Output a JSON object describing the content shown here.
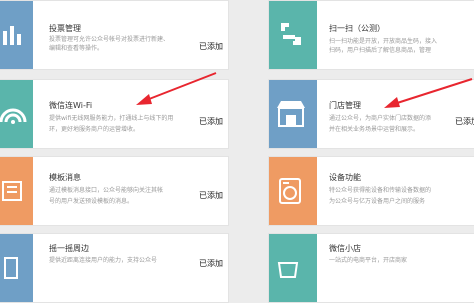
{
  "cards": [
    {
      "title": "投票管理",
      "desc1": "投票管理可允许公众号帐号对投票进行新建、",
      "desc2": "编辑和查看等操作。",
      "status": "已添加",
      "icon": "bar-chart-icon"
    },
    {
      "title": "扫一扫（公测）",
      "desc1": "扫一扫功能是开放，开放商品生码，接入",
      "desc2": "扫码，用户扫描后了解信息商品，管理",
      "status": "",
      "icon": "scan-icon"
    },
    {
      "title": "微信连Wi-Fi",
      "desc1": "提供wifi无线网服务能力，打通线上与线下的用",
      "desc2": "环，更好地服务商户的运营增收。",
      "status": "已添加",
      "icon": "wifi-icon"
    },
    {
      "title": "门店管理",
      "desc1": "通过公众号，为商户实体门店数据的添",
      "desc2": "并在相关业务场景中运营和展示。",
      "status": "已添加",
      "icon": "store-icon"
    },
    {
      "title": "模板消息",
      "desc1": "通过模板消息接口，公众号能够向关注其帐",
      "desc2": "号的用户发送预设模板的消息。",
      "status": "已添加",
      "icon": "message-template-icon"
    },
    {
      "title": "设备功能",
      "desc1": "特公众号获得能设备和传输设备数据的",
      "desc2": "为公众号与亿万设备用户之间的服务",
      "status": "",
      "icon": "device-icon"
    },
    {
      "title": "摇一摇周边",
      "desc1": "提供近距离连接用户的能力，支持公众号",
      "desc2": "",
      "status": "已添加",
      "icon": "shake-icon"
    },
    {
      "title": "微信小店",
      "desc1": "一站式的电商平台，开店商家",
      "desc2": "",
      "status": "",
      "icon": "shop-icon"
    }
  ],
  "colors": {
    "blue": "#6f9fc6",
    "teal": "#5ab5ab",
    "orange": "#ef9b63",
    "arrow": "#e8262f"
  }
}
